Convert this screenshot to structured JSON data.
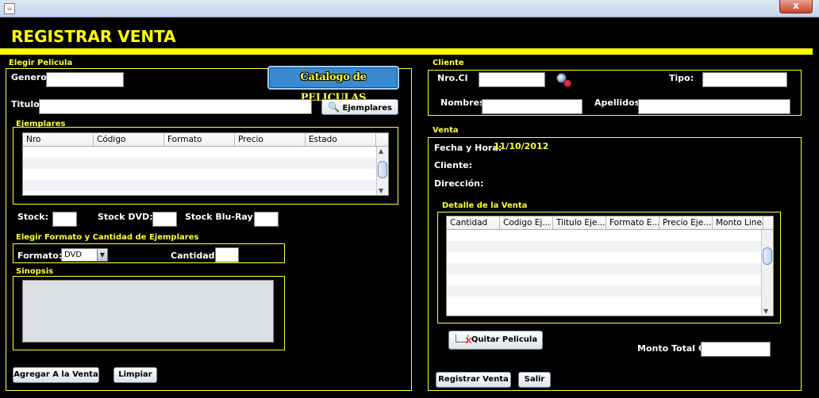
{
  "window": {
    "close_label": "x"
  },
  "title": "REGISTRAR VENTA",
  "left": {
    "elegir_pelicula_label": "Elegir Pelicula",
    "genero_label": "Genero:",
    "genero_value": "",
    "catalog_button_label": "Catalogo de PELICULAS",
    "titulo_label": "Titulo:",
    "titulo_value": "",
    "ejemplares_button_label": "Ejemplares",
    "ejemplares_section": "Ejemplares",
    "ejemplares_columns": [
      "Nro",
      "Código",
      "Formato",
      "Precio",
      "Estado"
    ],
    "stock_label": "Stock:",
    "stock_dvd_label": "Stock DVD:",
    "stock_bluray_label": "Stock Blu-Ray:",
    "formato_section": "Elegir Formato y Cantidad de Ejemplares",
    "formato_label": "Formato:",
    "formato_selected": "DVD",
    "cantidad_label": "Cantidad:",
    "sinopsis_section": "Sinopsis",
    "agregar_button": "Agregar A la Venta",
    "limpiar_button": "Limpiar"
  },
  "right": {
    "cliente_section": "Cliente",
    "nro_ci_label": "Nro.CI",
    "tipo_label": "Tipo:",
    "nombres_label": "Nombres:",
    "apellidos_label": "Apellidos:",
    "venta_section": "Venta",
    "fecha_label": "Fecha y Hora:",
    "fecha_value": "11/10/2012",
    "cliente_label": "Cliente:",
    "direccion_label": "Dirección:",
    "detalle_section": "Detalle de la Venta",
    "detalle_columns": [
      "Cantidad",
      "Codigo Ej...",
      "Tiitulo Eje...",
      "Formato E...",
      "Precio Eje...",
      "Monto Linea"
    ],
    "quitar_button": "Quitar Pelicula",
    "monto_label": "Monto Total GS :",
    "registrar_button": "Registrar Venta",
    "salir_button": "Salir"
  },
  "colors": {
    "accent": "#ffff00",
    "background": "#000000"
  },
  "icons": {
    "search": "search-user-icon",
    "magnifier": "magnifier-icon",
    "cart": "cart-remove-icon"
  }
}
